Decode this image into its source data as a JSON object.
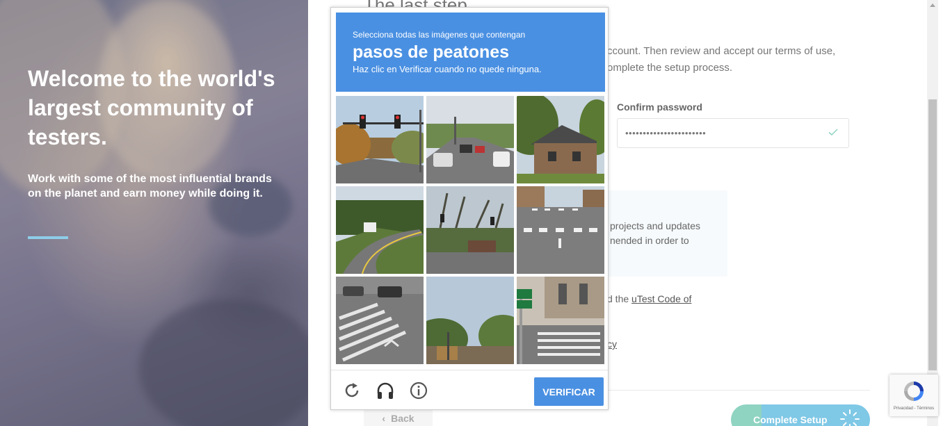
{
  "hero": {
    "title": "Welcome to the world's largest community of testers.",
    "subtitle": "Work with some of the most influential brands on the planet and earn money while doing it."
  },
  "form": {
    "heading": "The last step",
    "intro": "ccount. Then review and accept our terms of use, omplete the setup process.",
    "confirm_password_label": "Confirm password",
    "confirm_password_value": "•••••••••••••••••••••••",
    "info_text": "projects and updates nended in order to",
    "code_of_conduct_prefix": "d the ",
    "code_of_conduct_link": "uTest Code of",
    "policy_link": "cy",
    "back_label": "Back",
    "complete_label": "Complete Setup"
  },
  "captcha": {
    "instruction": "Selecciona todas las imágenes que contengan",
    "target": "pasos de peatones",
    "hint": "Haz clic en Verificar cuando no quede ninguna.",
    "verify_label": "VERIFICAR",
    "tiles": [
      "traffic-lights-intersection",
      "street-with-cars",
      "brick-house",
      "curved-road",
      "road-with-trees",
      "crosswalk-street",
      "crosswalk-corner",
      "trees-road",
      "crosswalk-sign-corner"
    ]
  },
  "badge": {
    "links": "Privacidad - Términos"
  },
  "colors": {
    "captcha_blue": "#4a90e2",
    "hero_rule": "#8ecde9",
    "complete_button": "#7fc8e6"
  }
}
